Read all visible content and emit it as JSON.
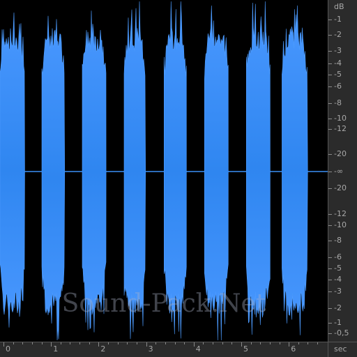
{
  "colors": {
    "background": "#000000",
    "waveform": "#3a8ff5",
    "waveform_peak": "#4d9cff",
    "ruler_bg": "#2b2b2b",
    "ruler_text": "#a8a8a8"
  },
  "watermark": "Sound-Pack.Net",
  "db_scale": {
    "unit": "dB",
    "labels_top": [
      "-1",
      "-2",
      "-3",
      "-4",
      "-5",
      "-6",
      "-8",
      "-10",
      "-12",
      "-20"
    ],
    "center": "-∞",
    "labels_bottom": [
      "-20",
      "-12",
      "-10",
      "-8",
      "-6",
      "-5",
      "-4",
      "-3",
      "-2",
      "-1",
      "-0,5"
    ]
  },
  "time_scale": {
    "unit": "sec",
    "labels": [
      "0",
      "1",
      "2",
      "3",
      "4",
      "5",
      "6"
    ]
  },
  "waveform": {
    "bursts": [
      {
        "start": 0.0,
        "end": 0.52
      },
      {
        "start": 0.88,
        "end": 1.36
      },
      {
        "start": 1.73,
        "end": 2.23
      },
      {
        "start": 2.61,
        "end": 3.06
      },
      {
        "start": 3.45,
        "end": 3.92
      },
      {
        "start": 4.3,
        "end": 4.8
      },
      {
        "start": 5.18,
        "end": 5.68
      },
      {
        "start": 5.93,
        "end": 6.47
      }
    ],
    "duration_sec": 6.7
  }
}
